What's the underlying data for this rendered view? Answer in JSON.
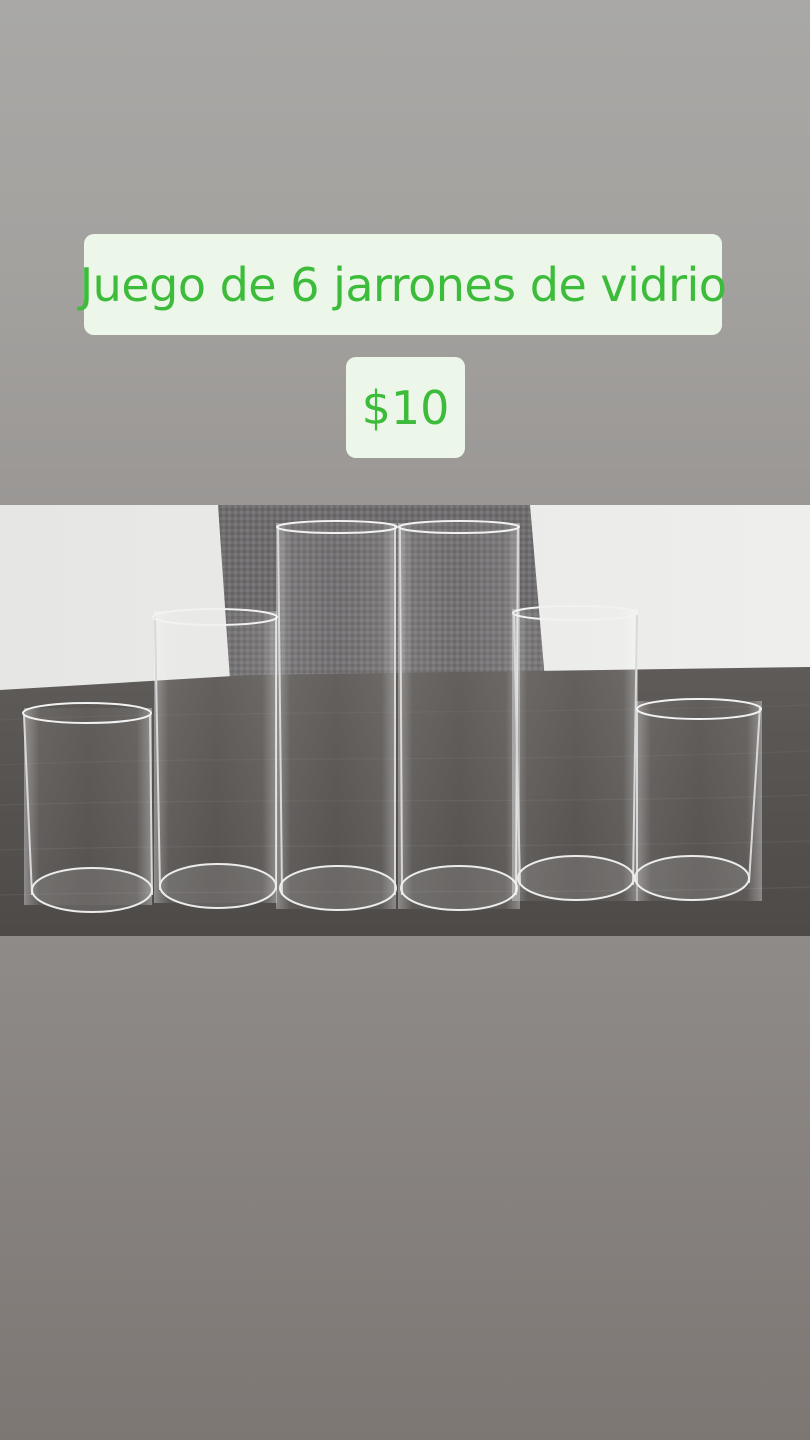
{
  "story": {
    "title_text": "Juego de 6 jarrones de vidrio",
    "price_text": "$10",
    "accent_color": "#3cbc3a",
    "caption_bg": "#ecf7ea"
  },
  "photo": {
    "subject": "six clear glass cylinder vases on a dark wooden table",
    "item_count": 6
  }
}
